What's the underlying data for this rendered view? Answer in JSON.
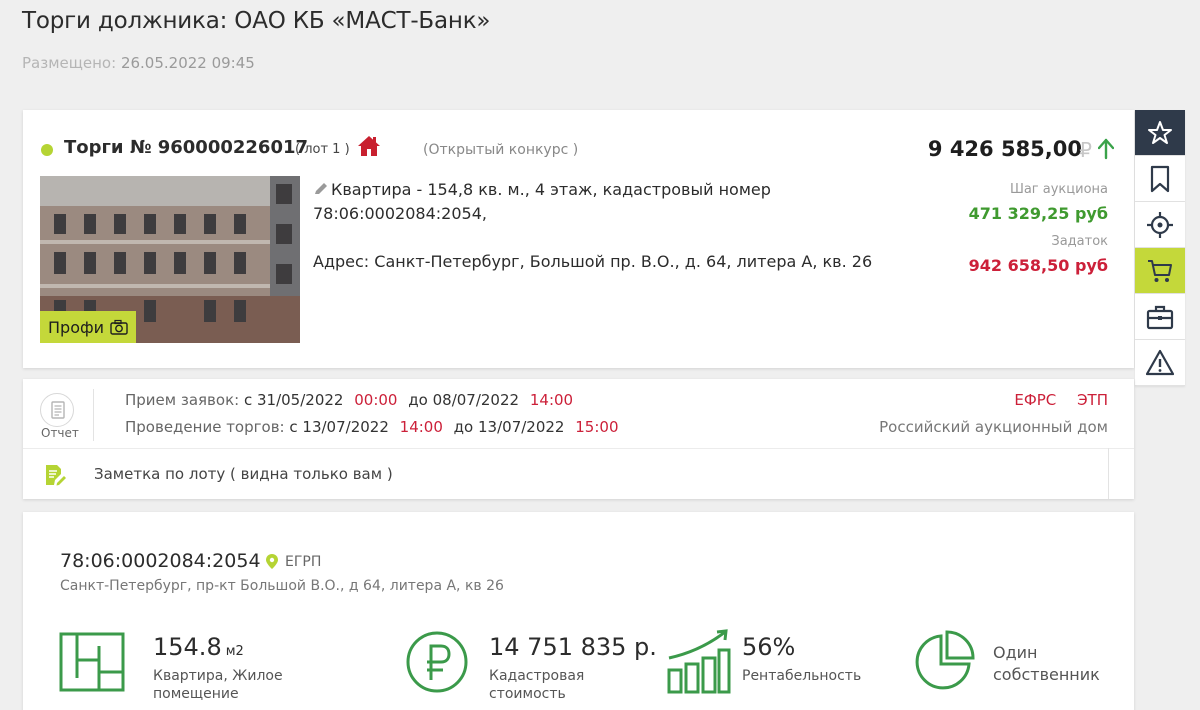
{
  "page": {
    "title": "Торги должника: ОАО КБ «МАСТ-Банк»",
    "posted_label": "Размещено:",
    "posted_date": "26.05.2022 09:45"
  },
  "lot": {
    "auction_number": "Торги № 960000226017",
    "lot_label": "( лот 1 )",
    "auction_type": "(Открытый конкурс )",
    "price": "9 426 585,00",
    "currency_symbol": "₽",
    "photo_badge": "Профи",
    "description": "Квартира - 154,8 кв. м., 4 этаж, кадастровый номер 78:06:0002084:2054,",
    "address": "Адрес: Санкт-Петербург, Большой пр. В.О., д. 64, литера А, кв. 26",
    "step_label": "Шаг аукциона",
    "step_value": "471 329,25 руб",
    "deposit_label": "Задаток",
    "deposit_value": "942 658,50 руб"
  },
  "toolbar": {
    "items": [
      "star-icon",
      "bookmark-icon",
      "target-icon",
      "cart-icon",
      "briefcase-icon",
      "warning-icon"
    ]
  },
  "schedule": {
    "report_label": "Отчет",
    "applications_label": "Прием заявок:",
    "applications_from_prefix": "с",
    "applications_from_date": "31/05/2022",
    "applications_from_time": "00:00",
    "applications_to_prefix": "до",
    "applications_to_date": "08/07/2022",
    "applications_to_time": "14:00",
    "bidding_label": "Проведение торгов:",
    "bidding_from_prefix": "с",
    "bidding_from_date": "13/07/2022",
    "bidding_from_time": "14:00",
    "bidding_to_prefix": "до",
    "bidding_to_date": "13/07/2022",
    "bidding_to_time": "15:00",
    "link_efrs": "ЕФРС",
    "link_etp": "ЭТП",
    "operator": "Российский аукционный дом",
    "note": "Заметка по лоту ( видна только вам )"
  },
  "egrp": {
    "cadastral_number": "78:06:0002084:2054",
    "source": "ЕГРП",
    "address": "Санкт-Петербург, пр-кт Большой В.О., д 64, литера А, кв 26",
    "area_value": "154.8",
    "area_unit": "м2",
    "area_desc_1": "Квартира, Жилое",
    "area_desc_2": "помещение",
    "cadastral_cost": "14 751 835 р.",
    "cost_desc_1": "Кадастровая",
    "cost_desc_2": "стоимость",
    "profitability": "56%",
    "profitability_desc": "Рентабельность",
    "owners_1": "Один",
    "owners_2": "собственник"
  },
  "colors": {
    "accent_green": "#b5d434",
    "dark_nav": "#2f3a4a",
    "price_red": "#cc2039",
    "step_green": "#3f9a2f",
    "icon_green": "#4a9d3a"
  }
}
